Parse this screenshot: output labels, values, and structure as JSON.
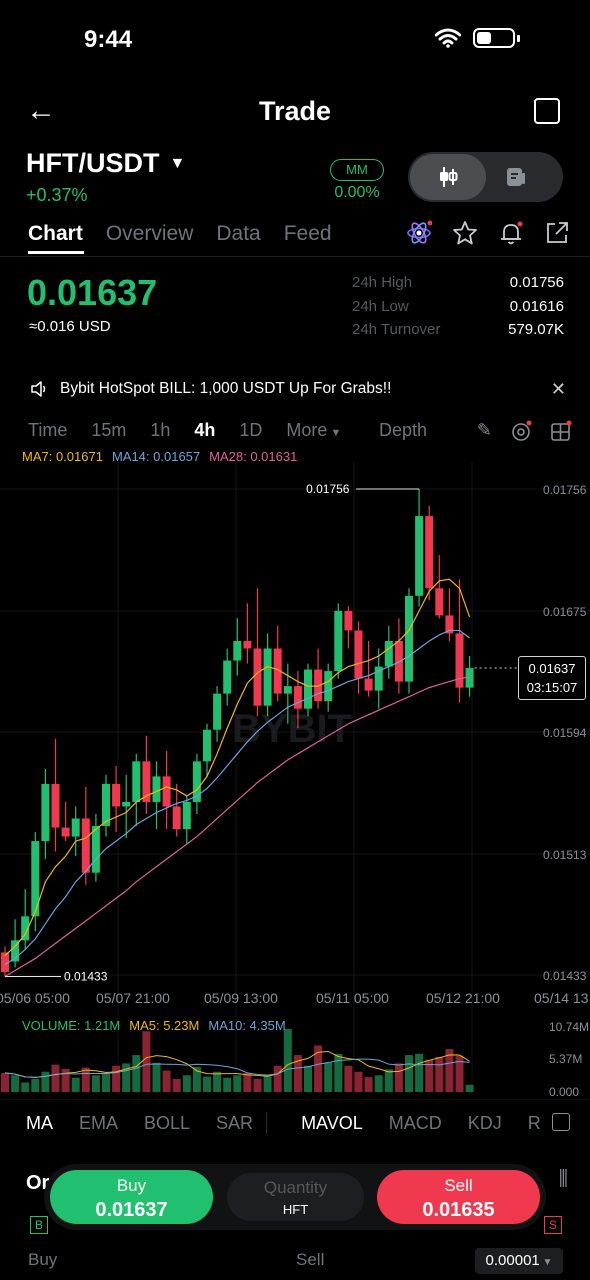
{
  "status_bar": {
    "time": "9:44"
  },
  "header": {
    "title": "Trade"
  },
  "pair": {
    "symbol": "HFT/USDT",
    "change": "+0.37%",
    "mm_badge": "MM",
    "mm_value": "0.00%"
  },
  "tabs": [
    {
      "label": "Chart"
    },
    {
      "label": "Overview"
    },
    {
      "label": "Data"
    },
    {
      "label": "Feed"
    }
  ],
  "ticker": {
    "last_price": "0.01637",
    "usd_value": "≈0.016 USD",
    "stats": [
      {
        "label": "24h High",
        "value": "0.01756"
      },
      {
        "label": "24h Low",
        "value": "0.01616"
      },
      {
        "label": "24h Turnover",
        "value": "579.07K"
      }
    ]
  },
  "announcement": {
    "text": "Bybit HotSpot BILL: 1,000 USDT Up For Grabs!!"
  },
  "intervals": [
    {
      "label": "Time"
    },
    {
      "label": "15m"
    },
    {
      "label": "1h"
    },
    {
      "label": "4h"
    },
    {
      "label": "1D"
    },
    {
      "label": "More"
    }
  ],
  "depth_label": "Depth",
  "ma_legend": {
    "ma7": "MA7: 0.01671",
    "ma14": "MA14: 0.01657",
    "ma28": "MA28: 0.01631"
  },
  "colors": {
    "up": "#20c06f",
    "down": "#f0384f",
    "ma7": "#f0b90b",
    "ma14": "#6aa5d8",
    "ma28": "#e0609a"
  },
  "chart_data": {
    "type": "candlestick",
    "interval": "4h",
    "ylim": [
      0.01433,
      0.01756
    ],
    "y_ticks": [
      "0.01756",
      "0.01675",
      "0.01594",
      "0.01513",
      "0.01433"
    ],
    "x_ticks": [
      "05/06 05:00",
      "05/07 21:00",
      "05/09 13:00",
      "05/11 05:00",
      "05/12 21:00",
      "05/14 13"
    ],
    "high_label": "0.01756",
    "low_label": "0.01433",
    "current_price": "0.01637",
    "countdown": "03:15:07",
    "watermark": "BYBIT",
    "volume": {
      "legend": {
        "volume": "VOLUME: 1.21M",
        "ma5": "MA5: 5.23M",
        "ma10": "MA10: 4.35M"
      },
      "y_ticks": [
        "10.74M",
        "5.37M",
        "0.000"
      ],
      "ymax": 10.74
    },
    "candles": [
      {
        "o": 0.01448,
        "h": 0.01452,
        "l": 0.01432,
        "c": 0.01435
      },
      {
        "o": 0.01442,
        "h": 0.0147,
        "l": 0.01438,
        "c": 0.01456
      },
      {
        "o": 0.01456,
        "h": 0.0149,
        "l": 0.0145,
        "c": 0.01472
      },
      {
        "o": 0.01472,
        "h": 0.01528,
        "l": 0.01462,
        "c": 0.01522
      },
      {
        "o": 0.01522,
        "h": 0.0157,
        "l": 0.0151,
        "c": 0.0156
      },
      {
        "o": 0.0156,
        "h": 0.0159,
        "l": 0.01515,
        "c": 0.01531
      },
      {
        "o": 0.01531,
        "h": 0.01548,
        "l": 0.01522,
        "c": 0.01525
      },
      {
        "o": 0.01525,
        "h": 0.01545,
        "l": 0.01512,
        "c": 0.01537
      },
      {
        "o": 0.01537,
        "h": 0.01558,
        "l": 0.01493,
        "c": 0.01501
      },
      {
        "o": 0.01501,
        "h": 0.0154,
        "l": 0.01495,
        "c": 0.01532
      },
      {
        "o": 0.01532,
        "h": 0.01566,
        "l": 0.01525,
        "c": 0.0156
      },
      {
        "o": 0.0156,
        "h": 0.01572,
        "l": 0.01528,
        "c": 0.01545
      },
      {
        "o": 0.01545,
        "h": 0.01566,
        "l": 0.01524,
        "c": 0.01548
      },
      {
        "o": 0.01548,
        "h": 0.0158,
        "l": 0.01532,
        "c": 0.01575
      },
      {
        "o": 0.01575,
        "h": 0.01592,
        "l": 0.0154,
        "c": 0.01548
      },
      {
        "o": 0.01548,
        "h": 0.01575,
        "l": 0.0153,
        "c": 0.01565
      },
      {
        "o": 0.01565,
        "h": 0.01582,
        "l": 0.0153,
        "c": 0.01545
      },
      {
        "o": 0.01545,
        "h": 0.0156,
        "l": 0.01525,
        "c": 0.0153
      },
      {
        "o": 0.0153,
        "h": 0.01552,
        "l": 0.0152,
        "c": 0.01548
      },
      {
        "o": 0.01548,
        "h": 0.0158,
        "l": 0.0154,
        "c": 0.01575
      },
      {
        "o": 0.01575,
        "h": 0.016,
        "l": 0.01565,
        "c": 0.01596
      },
      {
        "o": 0.01596,
        "h": 0.01625,
        "l": 0.01588,
        "c": 0.0162
      },
      {
        "o": 0.0162,
        "h": 0.0165,
        "l": 0.01612,
        "c": 0.01642
      },
      {
        "o": 0.01642,
        "h": 0.0167,
        "l": 0.01632,
        "c": 0.01655
      },
      {
        "o": 0.01655,
        "h": 0.0168,
        "l": 0.0164,
        "c": 0.0165
      },
      {
        "o": 0.0165,
        "h": 0.0169,
        "l": 0.01605,
        "c": 0.01612
      },
      {
        "o": 0.01612,
        "h": 0.0166,
        "l": 0.01605,
        "c": 0.0165
      },
      {
        "o": 0.0165,
        "h": 0.01665,
        "l": 0.01615,
        "c": 0.0162
      },
      {
        "o": 0.0162,
        "h": 0.0164,
        "l": 0.016,
        "c": 0.01625
      },
      {
        "o": 0.01625,
        "h": 0.01635,
        "l": 0.01597,
        "c": 0.0161
      },
      {
        "o": 0.0161,
        "h": 0.0164,
        "l": 0.01605,
        "c": 0.01636
      },
      {
        "o": 0.01636,
        "h": 0.0165,
        "l": 0.0161,
        "c": 0.01615
      },
      {
        "o": 0.01615,
        "h": 0.0164,
        "l": 0.01608,
        "c": 0.01635
      },
      {
        "o": 0.01635,
        "h": 0.0168,
        "l": 0.0163,
        "c": 0.01675
      },
      {
        "o": 0.01675,
        "h": 0.01678,
        "l": 0.0165,
        "c": 0.01662
      },
      {
        "o": 0.01662,
        "h": 0.01668,
        "l": 0.0162,
        "c": 0.0163
      },
      {
        "o": 0.0163,
        "h": 0.01655,
        "l": 0.01618,
        "c": 0.01622
      },
      {
        "o": 0.01622,
        "h": 0.0165,
        "l": 0.0161,
        "c": 0.01638
      },
      {
        "o": 0.01638,
        "h": 0.01665,
        "l": 0.0163,
        "c": 0.01655
      },
      {
        "o": 0.01655,
        "h": 0.0167,
        "l": 0.0162,
        "c": 0.01628
      },
      {
        "o": 0.01628,
        "h": 0.0169,
        "l": 0.0162,
        "c": 0.01685
      },
      {
        "o": 0.01685,
        "h": 0.01756,
        "l": 0.01678,
        "c": 0.01738
      },
      {
        "o": 0.01738,
        "h": 0.01745,
        "l": 0.01682,
        "c": 0.0169
      },
      {
        "o": 0.0169,
        "h": 0.01712,
        "l": 0.0167,
        "c": 0.01672
      },
      {
        "o": 0.01672,
        "h": 0.0169,
        "l": 0.01655,
        "c": 0.0166
      },
      {
        "o": 0.0166,
        "h": 0.01696,
        "l": 0.01614,
        "c": 0.01624
      },
      {
        "o": 0.01624,
        "h": 0.01645,
        "l": 0.01618,
        "c": 0.01637
      }
    ],
    "volumes": [
      3.2,
      2.8,
      1.6,
      2.2,
      3.4,
      4.6,
      3.9,
      2.4,
      4.1,
      2.8,
      3.2,
      4.4,
      4.8,
      6.2,
      10.2,
      4.9,
      3.6,
      2.2,
      2.8,
      4.2,
      2.6,
      3.4,
      2.4,
      2.8,
      3.2,
      2.2,
      2.6,
      4.4,
      10.6,
      6.2,
      4.4,
      7.8,
      5.0,
      6.4,
      4.4,
      3.4,
      2.5,
      2.8,
      3.8,
      4.8,
      6.2,
      6.4,
      5.4,
      5.9,
      7.2,
      6.1,
      1.21
    ],
    "ma7": [
      0.01446,
      0.01452,
      0.0146,
      0.01475,
      0.01495,
      0.01505,
      0.01512,
      0.01522,
      0.01524,
      0.0153,
      0.01535,
      0.01538,
      0.01541,
      0.01548,
      0.01552,
      0.01555,
      0.01558,
      0.01556,
      0.01552,
      0.01556,
      0.01565,
      0.0158,
      0.01597,
      0.01613,
      0.01627,
      0.01634,
      0.01638,
      0.01636,
      0.01632,
      0.01628,
      0.01625,
      0.01625,
      0.01628,
      0.01634,
      0.01638,
      0.0164,
      0.01642,
      0.01645,
      0.0165,
      0.01655,
      0.01662,
      0.01675,
      0.01688,
      0.01695,
      0.01696,
      0.0169,
      0.01671
    ],
    "ma14": [
      0.0144,
      0.01444,
      0.0145,
      0.01457,
      0.01467,
      0.01477,
      0.01485,
      0.01495,
      0.01502,
      0.0151,
      0.01517,
      0.01522,
      0.01527,
      0.01533,
      0.01537,
      0.01541,
      0.01544,
      0.01547,
      0.01549,
      0.01552,
      0.01557,
      0.01564,
      0.01572,
      0.0158,
      0.01588,
      0.01595,
      0.01601,
      0.01606,
      0.01611,
      0.01614,
      0.01617,
      0.0162,
      0.01622,
      0.01625,
      0.01628,
      0.0163,
      0.01632,
      0.01635,
      0.01638,
      0.01641,
      0.01645,
      0.0165,
      0.01655,
      0.01659,
      0.01662,
      0.01662,
      0.01657
    ],
    "ma28": [
      0.01432,
      0.01436,
      0.0144,
      0.01444,
      0.01449,
      0.01454,
      0.01459,
      0.01464,
      0.01469,
      0.01474,
      0.01479,
      0.01484,
      0.01489,
      0.01495,
      0.015,
      0.01505,
      0.0151,
      0.01515,
      0.0152,
      0.01525,
      0.01531,
      0.01537,
      0.01543,
      0.01549,
      0.01555,
      0.01561,
      0.01566,
      0.01571,
      0.01576,
      0.0158,
      0.01584,
      0.01588,
      0.01592,
      0.01596,
      0.016,
      0.01603,
      0.01606,
      0.01609,
      0.01612,
      0.01615,
      0.01618,
      0.01621,
      0.01624,
      0.01626,
      0.01628,
      0.0163,
      0.01631
    ]
  },
  "indicator_tabs": [
    {
      "label": "MA"
    },
    {
      "label": "EMA"
    },
    {
      "label": "BOLL"
    },
    {
      "label": "SAR"
    },
    {
      "label": "MAVOL"
    },
    {
      "label": "MACD"
    },
    {
      "label": "KDJ"
    },
    {
      "label": "R"
    }
  ],
  "order_buttons": {
    "buy_label": "Buy",
    "buy_price": "0.01637",
    "qty_label": "Quantity",
    "qty_unit": "HFT",
    "sell_label": "Sell",
    "sell_price": "0.01635"
  },
  "orderbook": {
    "tab_label": "Or",
    "buy_marker": "B",
    "sell_marker": "S",
    "buy_col": "Buy",
    "sell_col": "Sell",
    "precision": "0.00001"
  }
}
